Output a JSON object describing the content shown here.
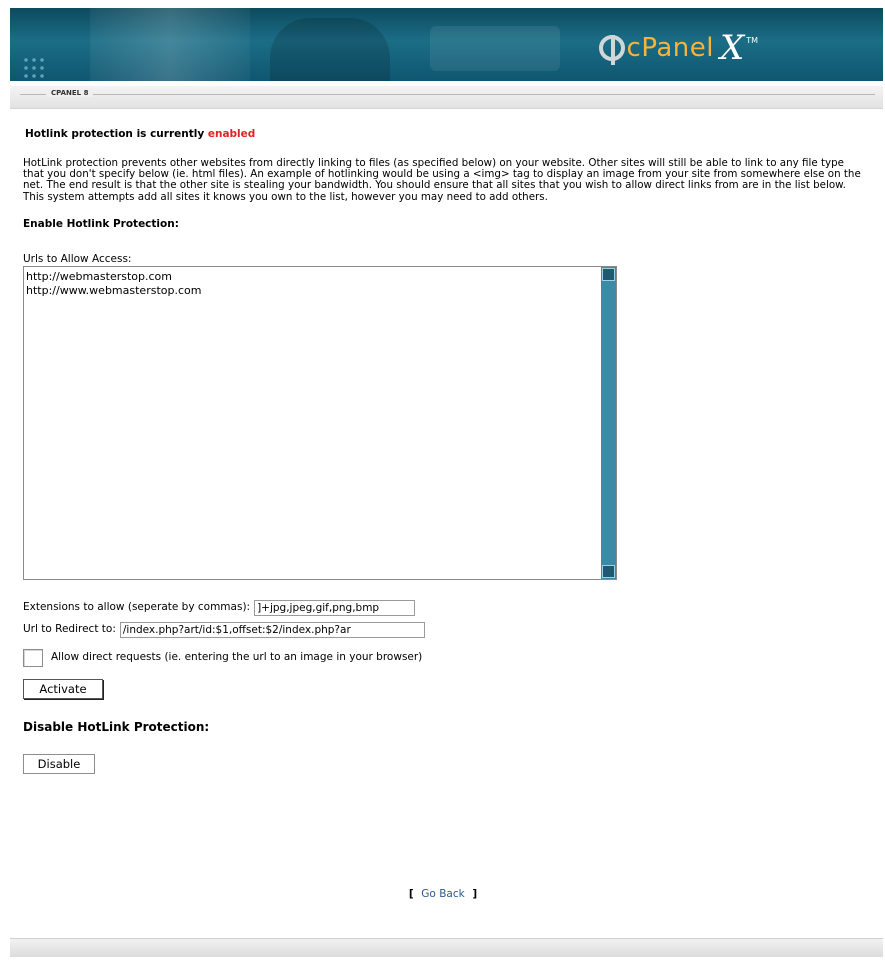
{
  "header": {
    "logo_text": "cPanel",
    "logo_x": "X",
    "logo_tm": "TM"
  },
  "section_label": "CPANEL 8",
  "status": {
    "prefix": "Hotlink protection is currently ",
    "state": "enabled"
  },
  "description": "HotLink protection prevents other websites from directly linking to files (as specified below) on your website. Other sites will still be able to link to any file type that you don't specify below (ie. html files). An example of hotlinking would be using a <img> tag to display an image from your site from somewhere else on the net. The end result is that the other site is stealing your bandwidth. You should ensure that all sites that you wish to allow direct links from are in the list below. This system attempts add all sites it knows you own to the list, however you may need to add others.",
  "enable_title": "Enable Hotlink Protection:",
  "urls_label": "Urls to Allow Access:",
  "urls_value": "http://webmasterstop.com\nhttp://www.webmasterstop.com",
  "extensions_label": "Extensions to allow (seperate by commas):",
  "extensions_value": "]+jpg,jpeg,gif,png,bmp",
  "redirect_label": "Url to Redirect to:",
  "redirect_value": "/index.php?art/id:$1,offset:$2/index.php?ar",
  "direct_requests_label": "Allow direct requests (ie. entering the url to an image in your browser)",
  "activate_label": "Activate",
  "disable_title": "Disable HotLink Protection:",
  "disable_label": "Disable",
  "goback": {
    "open": "[",
    "label": "Go Back",
    "close": "]"
  },
  "colors": {
    "header": "#0f5670",
    "enabled": "#e22222",
    "link": "#2a5a8a",
    "scrollbar": "#3b8aa6"
  }
}
